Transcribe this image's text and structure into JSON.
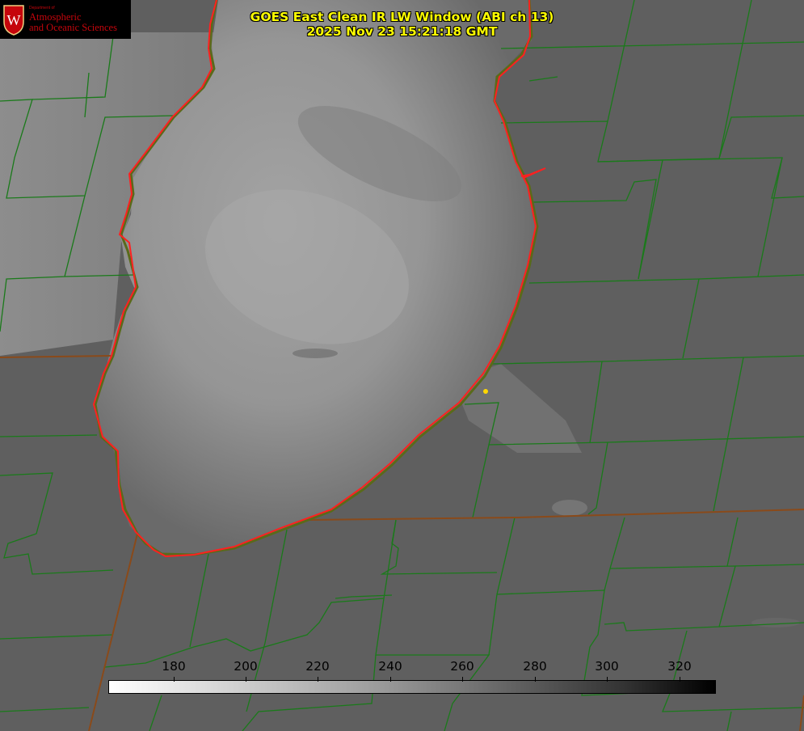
{
  "logo": {
    "dept": "Department of",
    "line1": "Atmospheric",
    "line2": "and Oceanic Sciences",
    "text": "W",
    "accent": "#c5050c"
  },
  "title": {
    "line1": "GOES East Clean IR LW Window (ABI ch 13)",
    "line2": "2025 Nov 23 15:21:18 GMT",
    "color": "#ffff00"
  },
  "colorbar": {
    "ticks": [
      "180",
      "200",
      "220",
      "240",
      "260",
      "280",
      "300",
      "320"
    ]
  },
  "colors": {
    "county_lines": "#1a7a1a",
    "state_lines": "#8a4a1a",
    "lake_outline": "#ff2020",
    "marker": "#ffd700"
  }
}
